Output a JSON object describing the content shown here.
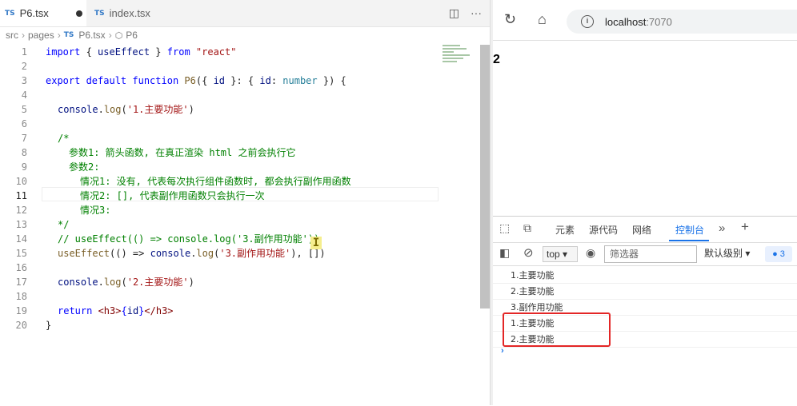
{
  "editor": {
    "tabs": [
      {
        "badge": "TS",
        "label": "P6.tsx",
        "modified": true
      },
      {
        "badge": "TS",
        "label": "index.tsx",
        "modified": false
      }
    ],
    "actions": {
      "split": "◫",
      "more": "···"
    },
    "breadcrumb": {
      "src": "src",
      "pages": "pages",
      "file_badge": "TS",
      "file": "P6.tsx",
      "symbol": "P6"
    },
    "line_numbers": [
      "1",
      "2",
      "3",
      "4",
      "5",
      "6",
      "7",
      "8",
      "9",
      "10",
      "11",
      "12",
      "13",
      "14",
      "15",
      "16",
      "17",
      "18",
      "19",
      "20"
    ],
    "current_line": "11",
    "code": {
      "l1": {
        "k1": "import",
        "p1": " { ",
        "v1": "useEffect",
        "p2": " } ",
        "k2": "from",
        "s1": " \"react\""
      },
      "l3": {
        "k1": "export",
        "k2": " default",
        "k3": " function",
        "f1": " P6",
        "p1": "({ ",
        "v1": "id",
        "p2": " }: { ",
        "v2": "id",
        "p3": ": ",
        "t1": "number",
        "p4": " }) {"
      },
      "l5": {
        "v1": "console",
        "p1": ".",
        "f1": "log",
        "p2": "(",
        "s1": "'1.主要功能'",
        "p3": ")"
      },
      "l7": "/*",
      "l8": "参数1: 箭头函数, 在真正渲染 html 之前会执行它",
      "l9": "参数2:",
      "l10": "情况1: 没有, 代表每次执行组件函数时, 都会执行副作用函数",
      "l11": "情况2: [], 代表副作用函数只会执行一次",
      "l12": "情况3:",
      "l13": "*/",
      "l14": "// useEffect(() => console.log('3.副作用功能'))",
      "l15": {
        "f1": "useEffect",
        "p1": "(() => ",
        "v1": "console",
        "p2": ".",
        "f2": "log",
        "p3": "(",
        "s1": "'3.副作用功能'",
        "p4": "), [])"
      },
      "l17": {
        "v1": "console",
        "p1": ".",
        "f1": "log",
        "p2": "(",
        "s1": "'2.主要功能'",
        "p3": ")"
      },
      "l19": {
        "k1": "return",
        "t1": " <h3>",
        "p1": "{",
        "v1": "id",
        "p2": "}",
        "t2": "</h3>"
      },
      "l20": "}"
    }
  },
  "browser": {
    "reload_icon": "↻",
    "home_icon": "⌂",
    "info_icon": "i",
    "url_host": "localhost",
    "url_port": ":7070",
    "page_content": "2"
  },
  "devtools": {
    "tabs": [
      "元素",
      "源代码",
      "网络",
      "控制台"
    ],
    "active_tab": "控制台",
    "more_tabs": "»",
    "add_tab": "+",
    "context": "top",
    "filter_placeholder": "筛选器",
    "level": "默认级别",
    "issues_count": "3",
    "logs": [
      "1.主要功能",
      "2.主要功能",
      "3.副作用功能",
      "1.主要功能",
      "2.主要功能"
    ],
    "prompt": "›"
  },
  "colors": {
    "highlight_box": "#e32626",
    "active_tab": "#1a73e8"
  }
}
